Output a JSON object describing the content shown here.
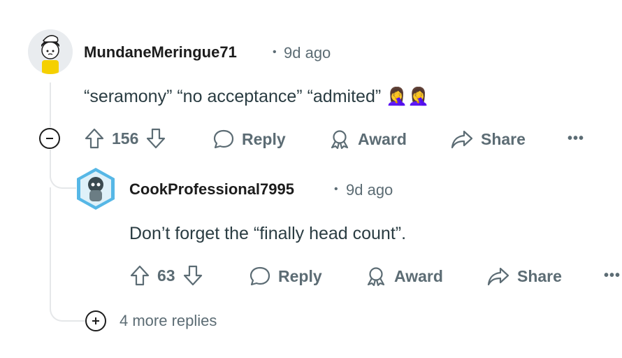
{
  "comment": {
    "username": "MundaneMeringue71",
    "time": "9d ago",
    "body": "“seramony” “no acceptance” “admited” 🤦‍♀️🤦‍♀️",
    "votes": "156",
    "reply_label": "Reply",
    "award_label": "Award",
    "share_label": "Share",
    "more_label": "•••"
  },
  "reply": {
    "username": "CookProfessional7995",
    "time": "9d ago",
    "body": "Don’t forget the “finally head count”.",
    "votes": "63",
    "reply_label": "Reply",
    "award_label": "Award",
    "share_label": "Share",
    "more_label": "•••"
  },
  "more_replies": {
    "label": "4 more replies"
  },
  "separator": "•",
  "icons": {
    "collapse": "minus-circle-icon",
    "expand": "plus-circle-icon",
    "upvote": "arrow-up-icon",
    "downvote": "arrow-down-icon",
    "reply": "speech-bubble-icon",
    "award": "award-ribbon-icon",
    "share": "share-arrow-icon"
  },
  "colors": {
    "meta": "#5c6c74",
    "text": "#2a3c42",
    "thread_line": "#e5e7e9"
  }
}
